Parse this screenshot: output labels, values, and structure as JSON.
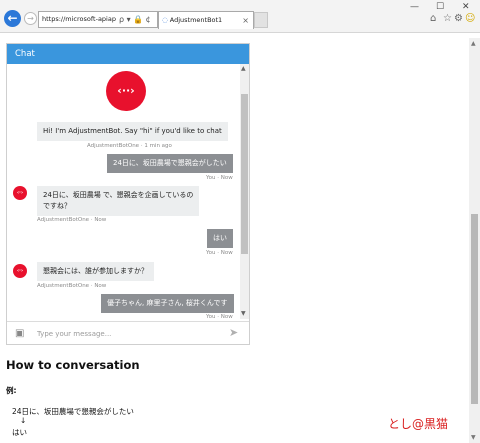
{
  "browser": {
    "address_url": "https://microsoft-apiapp93...",
    "tab_title": "AdjustmentBot1",
    "tab_close": "×",
    "address_icons": "ρ ▾ 🔒 ¢",
    "win_min": "—",
    "win_max": "☐",
    "win_close": "✕"
  },
  "chat": {
    "header": "Chat",
    "bot_hero_icon": "‹··›",
    "avatar_icon": "‹·›",
    "composer_placeholder": "Type your message...",
    "messages": [
      {
        "from": "bot",
        "text": "Hi! I'm AdjustmentBot. Say \"hi\" if you'd like to chat",
        "meta": "AdjustmentBotOne · 1 min ago"
      },
      {
        "from": "user",
        "text": "24日に、坂田農場で懇親会がしたい",
        "meta": "You · Now"
      },
      {
        "from": "bot",
        "text_line1": "24日に、坂田農場 で、懇親会を企画しているの",
        "text_line2": "ですね？",
        "meta": "AdjustmentBotOne · Now"
      },
      {
        "from": "user",
        "text": "はい",
        "meta": "You · Now"
      },
      {
        "from": "bot",
        "text": "懇親会には、誰が参加しますか？",
        "meta": "AdjustmentBotOne · Now"
      },
      {
        "from": "user",
        "text": "優子ちゃん, 麻里子さん, 桜井くんです",
        "meta": "You · Now"
      }
    ]
  },
  "page": {
    "title": "How to conversation",
    "example_label": "例:",
    "example_lines": [
      "24日に、坂田農場で懇親会がしたい",
      "↓",
      "はい"
    ],
    "signature": "とし@黒猫"
  },
  "colors": {
    "accent": "#3a96dd",
    "bot_red": "#e8112d",
    "user_bubble": "#8c8f93",
    "signature": "#d91e1e"
  },
  "icons": {
    "back": "back-arrow-icon",
    "forward": "forward-arrow-icon",
    "home": "home-icon",
    "favorites": "star-icon",
    "settings": "gear-icon",
    "feedback": "smiley-icon",
    "upload": "upload-icon",
    "send": "send-icon"
  }
}
